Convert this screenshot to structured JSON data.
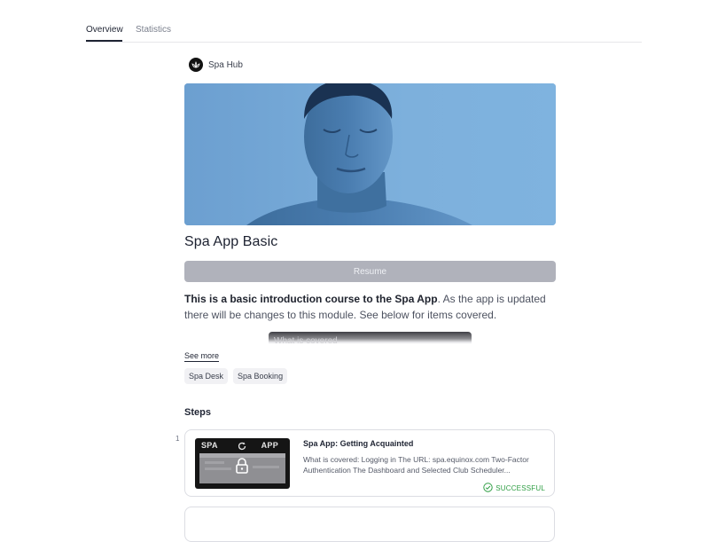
{
  "tabs": [
    {
      "label": "Overview",
      "active": true
    },
    {
      "label": "Statistics",
      "active": false
    }
  ],
  "brand": {
    "name": "Spa Hub",
    "icon": "lotus-icon"
  },
  "course": {
    "title": "Spa App Basic",
    "resume_label": "Resume",
    "description_bold": "This is a basic introduction course to the Spa App",
    "description_rest": ". As the app is updated there will be changes to this module. See below for items covered.",
    "preview_text": "What is covered",
    "see_more_label": "See more",
    "tags": [
      "Spa Desk",
      "Spa Booking"
    ]
  },
  "steps": {
    "heading": "Steps",
    "items": [
      {
        "number": "1",
        "thumb_left": "SPA",
        "thumb_right": "APP",
        "title": "Spa App: Getting Acquainted",
        "description": "What is covered: Logging in The URL: spa.equinox.com Two-Factor Authentication The Dashboard and Selected Club Scheduler...",
        "status": "SUCCESSFUL"
      }
    ]
  },
  "colors": {
    "accent": "#1f2433",
    "success": "#2f9e44",
    "disabled_button": "#b0b2bb",
    "hero_blue": "#79a9d4"
  }
}
